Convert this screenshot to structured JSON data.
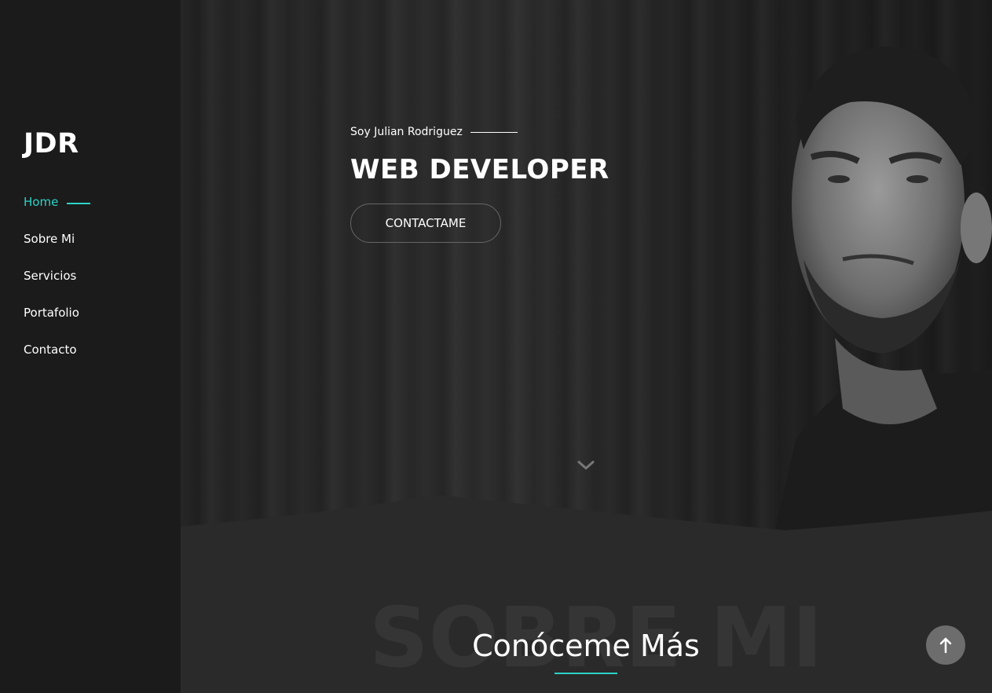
{
  "brand": {
    "logo": "JDR"
  },
  "sidebar": {
    "items": [
      {
        "label": "Home",
        "active": true
      },
      {
        "label": "Sobre Mi",
        "active": false
      },
      {
        "label": "Servicios",
        "active": false
      },
      {
        "label": "Portafolio",
        "active": false
      },
      {
        "label": "Contacto",
        "active": false
      }
    ]
  },
  "hero": {
    "intro": "Soy Julian Rodriguez",
    "role": "WEB DEVELOPER",
    "cta_label": "CONTACTAME"
  },
  "about": {
    "bg_title": "SOBRE MI",
    "title": "Conóceme Más"
  },
  "colors": {
    "accent": "#2bd3c6",
    "sidebar_bg": "#1b1b1b",
    "main_bg": "#2a2a2a"
  },
  "icons": {
    "scroll": "chevron-down-icon",
    "back_to_top": "arrow-up-icon"
  }
}
